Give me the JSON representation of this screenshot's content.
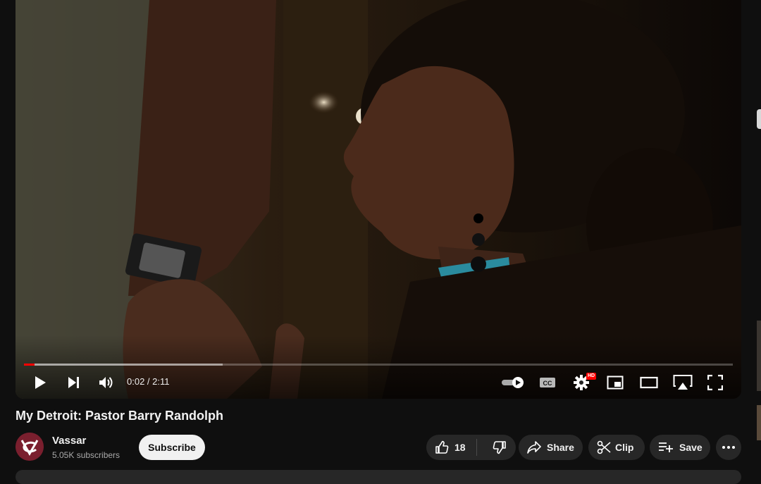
{
  "video": {
    "current_time": "0:02",
    "duration": "2:11",
    "time_separator": " / ",
    "progress_fraction": 0.015,
    "buffered_fraction": 0.28,
    "quality_badge": "HD"
  },
  "title": "My Detroit: Pastor Barry Randolph",
  "channel": {
    "name": "Vassar",
    "subscribers": "5.05K subscribers",
    "subscribe_label": "Subscribe"
  },
  "actions": {
    "like_count": "18",
    "share_label": "Share",
    "clip_label": "Clip",
    "save_label": "Save"
  },
  "icons": {
    "play": "play-icon",
    "next": "next-icon",
    "volume": "volume-icon",
    "autoplay": "autoplay-toggle-icon",
    "captions": "captions-icon",
    "settings": "gear-icon",
    "miniplayer": "miniplayer-icon",
    "theater": "theater-icon",
    "cast": "cast-icon",
    "fullscreen": "fullscreen-icon",
    "like": "thumbs-up-icon",
    "dislike": "thumbs-down-icon",
    "share": "share-arrow-icon",
    "clip": "scissors-icon",
    "save": "playlist-add-icon",
    "more": "more-horizontal-icon"
  },
  "colors": {
    "progress": "#ff0000",
    "background": "#0f0f0f",
    "pill": "#272727",
    "subscribe_bg": "#f1f1f1"
  }
}
